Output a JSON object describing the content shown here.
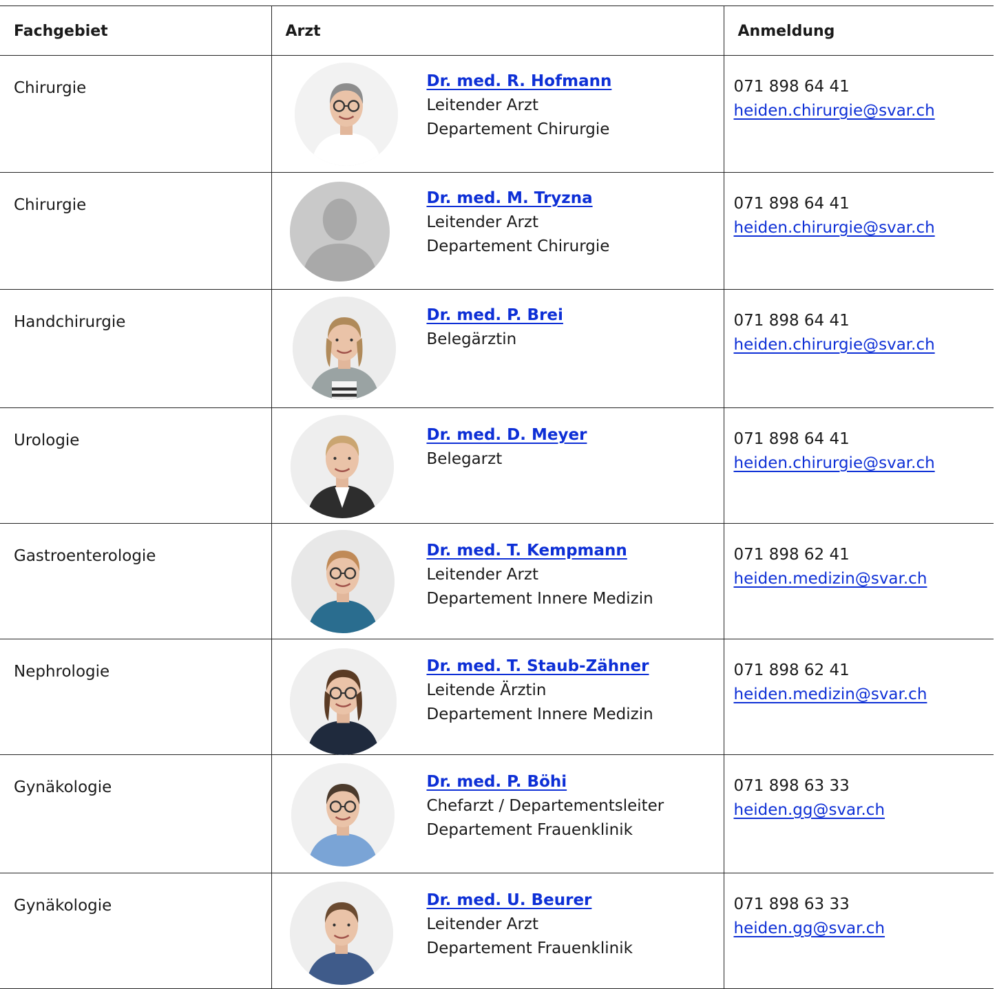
{
  "headers": {
    "specialty": "Fachgebiet",
    "doctor": "Arzt",
    "registration": "Anmeldung"
  },
  "colors": {
    "link": "#0d2fd6",
    "text": "#1a1a1a",
    "border": "#222222"
  },
  "rows": [
    {
      "specialty": "Chirurgie",
      "name": "Dr. med. R. Hofmann",
      "role": "Leitender Arzt",
      "dept": "Departement Chirurgie",
      "phone": "071 898 64 41",
      "email": "heiden.chirurgie@svar.ch",
      "photo": "photo-grey-haired-man-glasses"
    },
    {
      "specialty": "Chirurgie",
      "name": "Dr. med. M. Tryzna",
      "role": "Leitender Arzt",
      "dept": "Departement Chirurgie",
      "phone": "071 898 64 41",
      "email": "heiden.chirurgie@svar.ch",
      "photo": "person-placeholder-icon"
    },
    {
      "specialty": "Handchirurgie",
      "name": "Dr. med. P. Brei",
      "role": "Belegärztin",
      "dept": "",
      "phone": "071 898 64 41",
      "email": "heiden.chirurgie@svar.ch",
      "photo": "photo-woman"
    },
    {
      "specialty": "Urologie",
      "name": "Dr. med. D. Meyer",
      "role": "Belegarzt",
      "dept": "",
      "phone": "071 898 64 41",
      "email": "heiden.chirurgie@svar.ch",
      "photo": "photo-man-suit"
    },
    {
      "specialty": "Gastroenterologie",
      "name": "Dr. med. T. Kempmann",
      "role": "Leitender Arzt",
      "dept": "Departement Innere Medizin",
      "phone": "071 898 62 41",
      "email": "heiden.medizin@svar.ch",
      "photo": "photo-man-glasses"
    },
    {
      "specialty": "Nephrologie",
      "name": "Dr. med. T. Staub-Zähner",
      "role": "Leitende Ärztin",
      "dept": "Departement Innere Medizin",
      "phone": "071 898 62 41",
      "email": "heiden.medizin@svar.ch",
      "photo": "photo-woman-glasses"
    },
    {
      "specialty": "Gynäkologie",
      "name": "Dr. med. P. Böhi",
      "role": "Chefarzt / Departementsleiter",
      "dept": "Departement Frauenklinik",
      "phone": "071 898 63 33",
      "email": "heiden.gg@svar.ch",
      "photo": "photo-man-glasses-blue-shirt"
    },
    {
      "specialty": "Gynäkologie",
      "name": "Dr. med. U. Beurer",
      "role": "Leitender Arzt",
      "dept": "Departement Frauenklinik",
      "phone": "071 898 63 33",
      "email": "heiden.gg@svar.ch",
      "photo": "photo-man-checked-shirt"
    }
  ]
}
